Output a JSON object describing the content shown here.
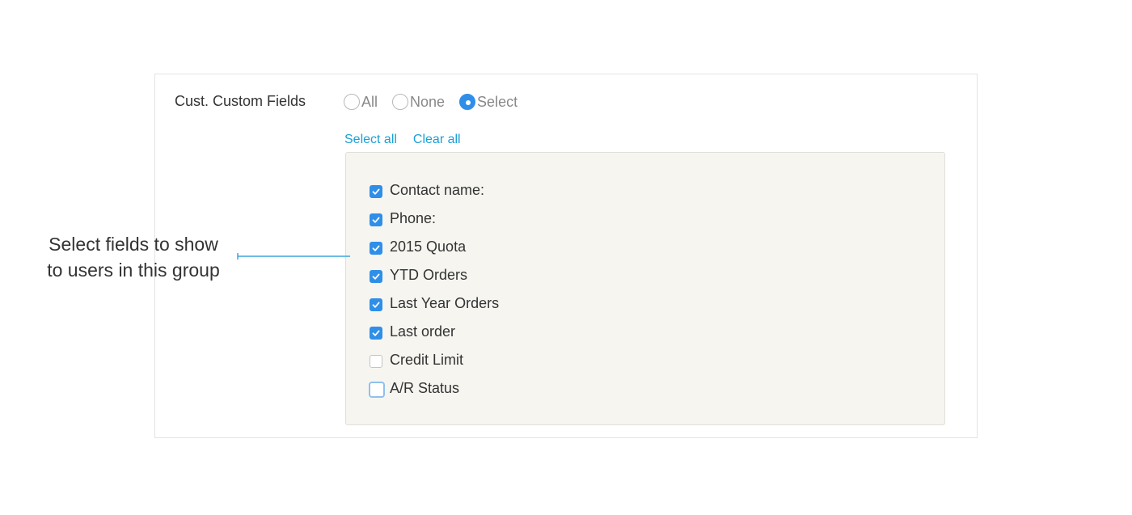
{
  "form": {
    "field_label": "Cust. Custom Fields",
    "radio_options": [
      {
        "label": "All",
        "checked": false
      },
      {
        "label": "None",
        "checked": false
      },
      {
        "label": "Select",
        "checked": true
      }
    ],
    "select_all_label": "Select all",
    "clear_all_label": "Clear all",
    "fields": [
      {
        "label": "Contact name:",
        "checked": true
      },
      {
        "label": "Phone:",
        "checked": true
      },
      {
        "label": "2015 Quota",
        "checked": true
      },
      {
        "label": "YTD Orders",
        "checked": true
      },
      {
        "label": "Last Year Orders",
        "checked": true
      },
      {
        "label": "Last order",
        "checked": true
      },
      {
        "label": "Credit Limit",
        "checked": false
      },
      {
        "label": "A/R Status",
        "checked": false,
        "focused": true
      }
    ]
  },
  "annotation": {
    "line1": "Select fields to show",
    "line2": "to users in this group"
  },
  "colors": {
    "accent": "#2f8fe8",
    "link": "#1aa0d8",
    "list_background": "#f6f5f0",
    "callout_line": "#3aa6dc"
  },
  "icons": {
    "checkmark": "checkmark-icon"
  }
}
